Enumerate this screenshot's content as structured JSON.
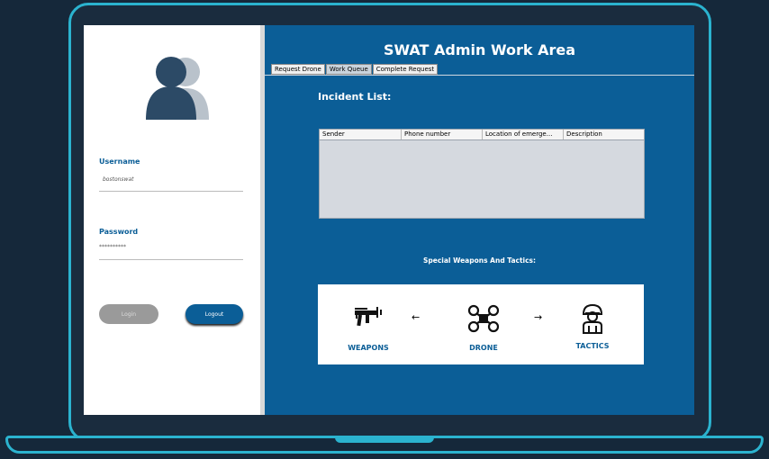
{
  "login": {
    "username_label": "Username",
    "username_value": "bostonswat",
    "password_label": "Password",
    "password_value": "**********",
    "login_label": "Login",
    "logout_label": "Logout"
  },
  "header": {
    "title": "SWAT Admin Work Area"
  },
  "tabs": [
    {
      "label": "Request Drone"
    },
    {
      "label": "Work Queue"
    },
    {
      "label": "Complete Request"
    }
  ],
  "incidents": {
    "heading": "Incident List:",
    "columns": [
      "Sender",
      "Phone number",
      "Location of emerge...",
      "Description"
    ],
    "rows": []
  },
  "swat": {
    "heading": "Special Weapons And Tactics:",
    "weapons_label": "WEAPONS",
    "drone_label": "DRONE",
    "tactics_label": "TACTICS",
    "arrow_left": "←",
    "arrow_right": "→"
  },
  "colors": {
    "brand_blue": "#0b5e97",
    "accent_cyan": "#2bb3cf"
  }
}
